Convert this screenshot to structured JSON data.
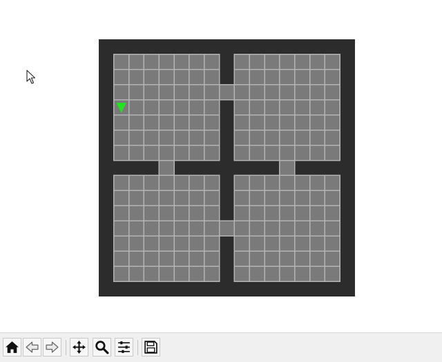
{
  "environment": {
    "grid_size": 17,
    "room_size": 7,
    "colors": {
      "background": "#ffffff",
      "wall": "#2c2c2c",
      "floor": "#7a7a7a",
      "grid_line": "#b4b4b4",
      "agent": "#1ee61e"
    },
    "doors": [
      {
        "row": 3,
        "col": 8
      },
      {
        "row": 8,
        "col": 4
      },
      {
        "row": 8,
        "col": 12
      },
      {
        "row": 12,
        "col": 8
      }
    ],
    "agent": {
      "row": 4,
      "col": 1,
      "direction": "down"
    }
  },
  "toolbar": {
    "buttons": [
      {
        "name": "home-button",
        "icon": "home-icon"
      },
      {
        "name": "back-button",
        "icon": "arrow-left-icon"
      },
      {
        "name": "forward-button",
        "icon": "arrow-right-icon"
      },
      {
        "name": "pan-button",
        "icon": "move-icon"
      },
      {
        "name": "zoom-button",
        "icon": "search-icon"
      },
      {
        "name": "configure-subplots-button",
        "icon": "sliders-icon"
      },
      {
        "name": "save-button",
        "icon": "floppy-disk-icon"
      }
    ]
  }
}
